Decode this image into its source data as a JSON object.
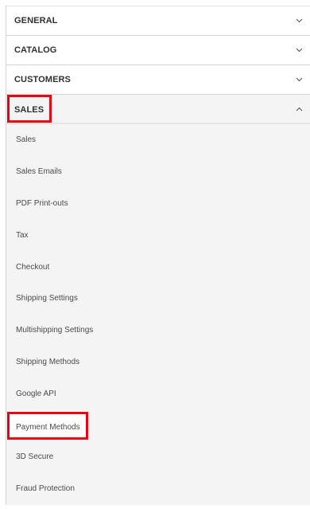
{
  "sections": {
    "general": "GENERAL",
    "catalog": "CATALOG",
    "customers": "CUSTOMERS",
    "sales": "SALES"
  },
  "sales_items": [
    "Sales",
    "Sales Emails",
    "PDF Print-outs",
    "Tax",
    "Checkout",
    "Shipping Settings",
    "Multishipping Settings",
    "Shipping Methods",
    "Google API",
    "Payment Methods",
    "3D Secure",
    "Fraud Protection"
  ],
  "icons": {
    "collapsed": "chevron-down-icon",
    "expanded": "chevron-up-icon"
  },
  "colors": {
    "highlight": "#e60012",
    "expanded_bg": "#f4f4f4"
  }
}
